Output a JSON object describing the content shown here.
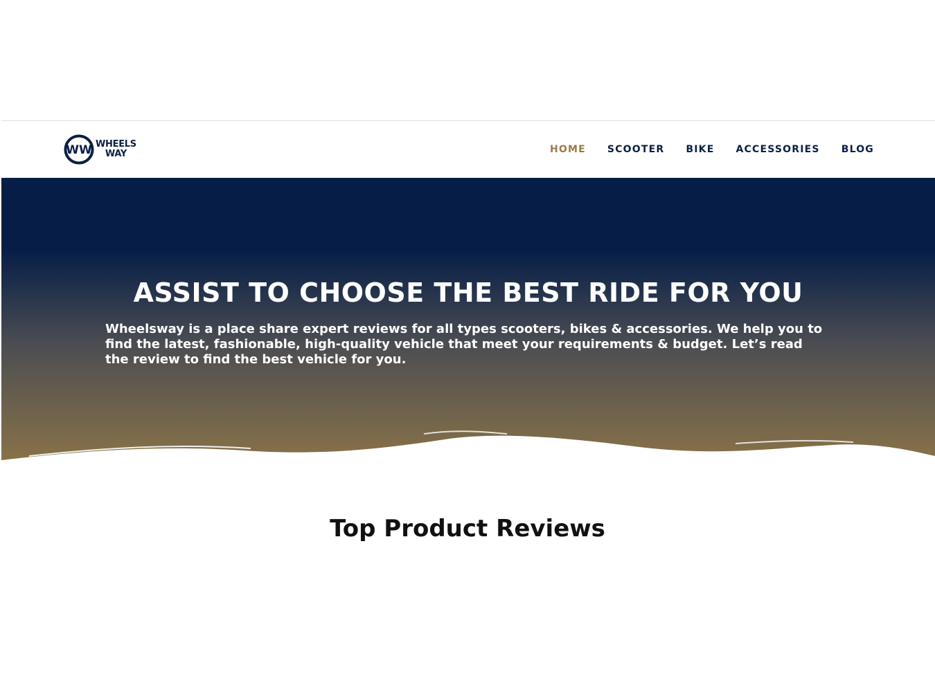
{
  "header": {
    "logo": {
      "monogram": "WW",
      "line1": "WHEELS",
      "line2": "WAY"
    },
    "nav": [
      {
        "label": "HOME",
        "active": true
      },
      {
        "label": "SCOOTER",
        "active": false
      },
      {
        "label": "BIKE",
        "active": false
      },
      {
        "label": "ACCESSORIES",
        "active": false
      },
      {
        "label": "BLOG",
        "active": false
      }
    ]
  },
  "hero": {
    "title": "ASSIST TO CHOOSE THE BEST RIDE FOR YOU",
    "text": "Wheelsway is a place share expert reviews for all types scooters, bikes & accessories. We help you to find the latest, fashionable, high-quality vehicle that meet your requirements & budget. Let’s read the review to find the best vehicle for you."
  },
  "reviews": {
    "title": "Top Product Reviews"
  },
  "colors": {
    "navy": "#061e47",
    "gold": "#9b7a45",
    "nav_text": "#0a1f44"
  }
}
